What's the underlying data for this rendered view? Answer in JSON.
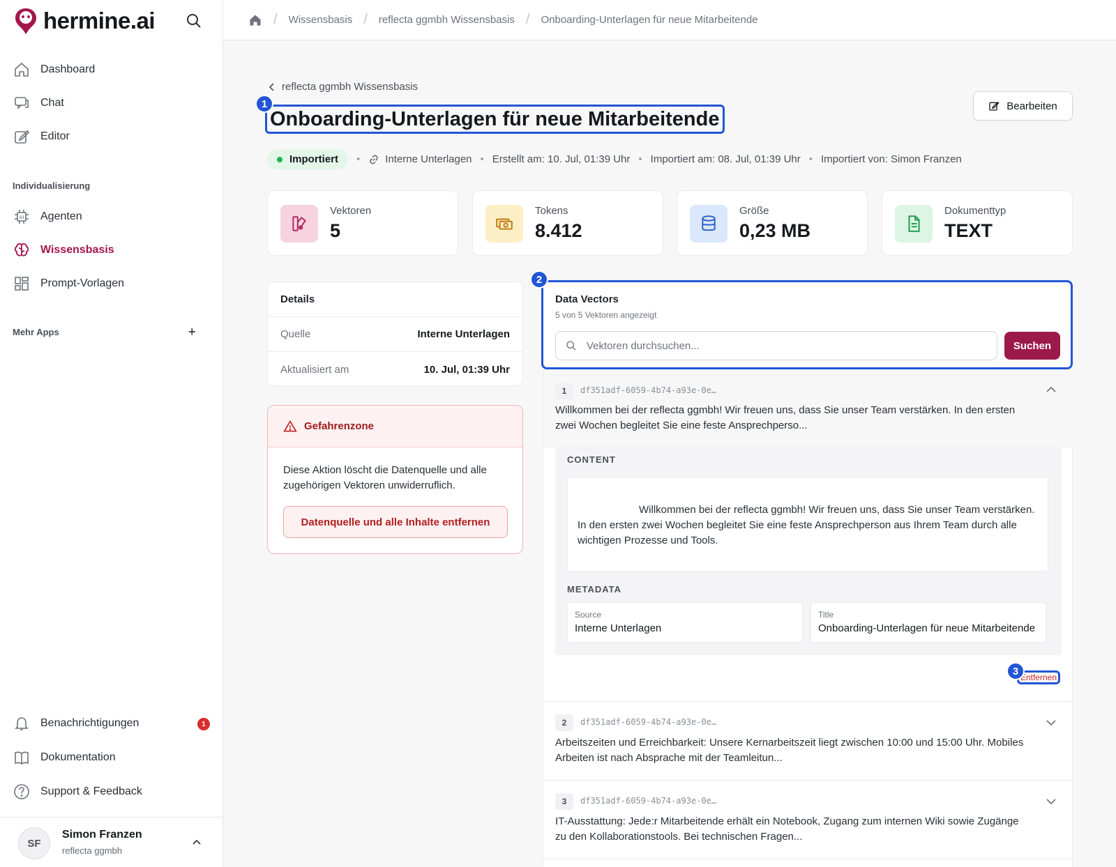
{
  "app": {
    "name": "hermine.ai"
  },
  "sidebar": {
    "main_items": [
      {
        "label": "Dashboard",
        "icon": "home-icon"
      },
      {
        "label": "Chat",
        "icon": "chat-icon"
      },
      {
        "label": "Editor",
        "icon": "edit-icon"
      }
    ],
    "section_individual": "Individualisierung",
    "individual_items": [
      {
        "label": "Agenten",
        "icon": "ai-chip-icon"
      },
      {
        "label": "Wissensbasis",
        "icon": "brain-icon",
        "active": true
      },
      {
        "label": "Prompt-Vorlagen",
        "icon": "grid-icon"
      }
    ],
    "section_more": "Mehr Apps",
    "bottom_items": [
      {
        "label": "Benachrichtigungen",
        "icon": "bell-icon",
        "badge": "1"
      },
      {
        "label": "Dokumentation",
        "icon": "book-icon"
      },
      {
        "label": "Support & Feedback",
        "icon": "help-icon"
      }
    ],
    "user": {
      "initials": "SF",
      "name": "Simon Franzen",
      "org": "reflecta ggmbh"
    }
  },
  "breadcrumb": [
    "Wissensbasis",
    "reflecta ggmbh Wissensbasis",
    "Onboarding-Unterlagen für neue Mitarbeitende"
  ],
  "header": {
    "back_label": "reflecta ggmbh Wissensbasis",
    "title": "Onboarding-Unterlagen für neue Mitarbeitende",
    "edit_label": "Bearbeiten",
    "status": "Importiert",
    "source": "Interne Unterlagen",
    "created": "Erstellt am: 10. Jul, 01:39 Uhr",
    "imported": "Importiert am: 08. Jul, 01:39 Uhr",
    "imported_by": "Importiert von: Simon Franzen"
  },
  "markers": {
    "title": "1",
    "vectors": "2",
    "remove": "3"
  },
  "stats": [
    {
      "label": "Vektoren",
      "value": "5",
      "icon": "vector-icon",
      "color": "#f7d3e0"
    },
    {
      "label": "Tokens",
      "value": "8.412",
      "icon": "coins-icon",
      "color": "#fcefc6"
    },
    {
      "label": "Größe",
      "value": "0,23 MB",
      "icon": "database-icon",
      "color": "#dbe8fb"
    },
    {
      "label": "Dokumenttyp",
      "value": "TEXT",
      "icon": "document-icon",
      "color": "#dcf5e4"
    }
  ],
  "details": {
    "title": "Details",
    "rows": [
      {
        "label": "Quelle",
        "value": "Interne Unterlagen"
      },
      {
        "label": "Aktualisiert am",
        "value": "10. Jul, 01:39 Uhr"
      }
    ]
  },
  "danger": {
    "title": "Gefahrenzone",
    "text": "Diese Aktion löscht die Datenquelle und alle zugehörigen Vektoren unwiderruflich.",
    "button": "Datenquelle und alle Inhalte entfernen"
  },
  "vectors": {
    "title": "Data Vectors",
    "subtitle": "5 von 5 Vektoren angezeigt",
    "search_placeholder": "Vektoren durchsuchen...",
    "search_button": "Suchen",
    "content_label": "CONTENT",
    "metadata_label": "METADATA",
    "remove_label": "Entfernen",
    "items": [
      {
        "num": "1",
        "id": "df351adf-6059-4b74-a93e-0e…",
        "preview": "Willkommen bei der reflecta ggmbh! Wir freuen uns, dass Sie unser Team verstärken. In den ersten zwei Wochen begleitet Sie eine feste Ansprechperso...",
        "content": "Willkommen bei der reflecta ggmbh! Wir freuen uns, dass Sie unser Team verstärken. In den ersten zwei Wochen begleitet Sie eine feste Ansprechperson aus Ihrem Team durch alle wichtigen Prozesse und Tools.",
        "meta_source_key": "Source",
        "meta_source": "Interne Unterlagen",
        "meta_title_key": "Title",
        "meta_title": "Onboarding-Unterlagen für neue Mitarbeitende"
      },
      {
        "num": "2",
        "id": "df351adf-6059-4b74-a93e-0e…",
        "preview": "Arbeitszeiten und Erreichbarkeit: Unsere Kernarbeitszeit liegt zwischen 10:00 und 15:00 Uhr. Mobiles Arbeiten ist nach Absprache mit der Teamleitun..."
      },
      {
        "num": "3",
        "id": "df351adf-6059-4b74-a93e-0e…",
        "preview": "IT-Ausstattung: Jede:r Mitarbeitende erhält ein Notebook, Zugang zum internen Wiki sowie Zugänge zu den Kollaborationstools. Bei technischen Fragen..."
      }
    ]
  },
  "colors": {
    "brand": "#a3164a",
    "highlight": "#2255d6",
    "danger": "#b21e1e",
    "success": "#22b04b"
  }
}
